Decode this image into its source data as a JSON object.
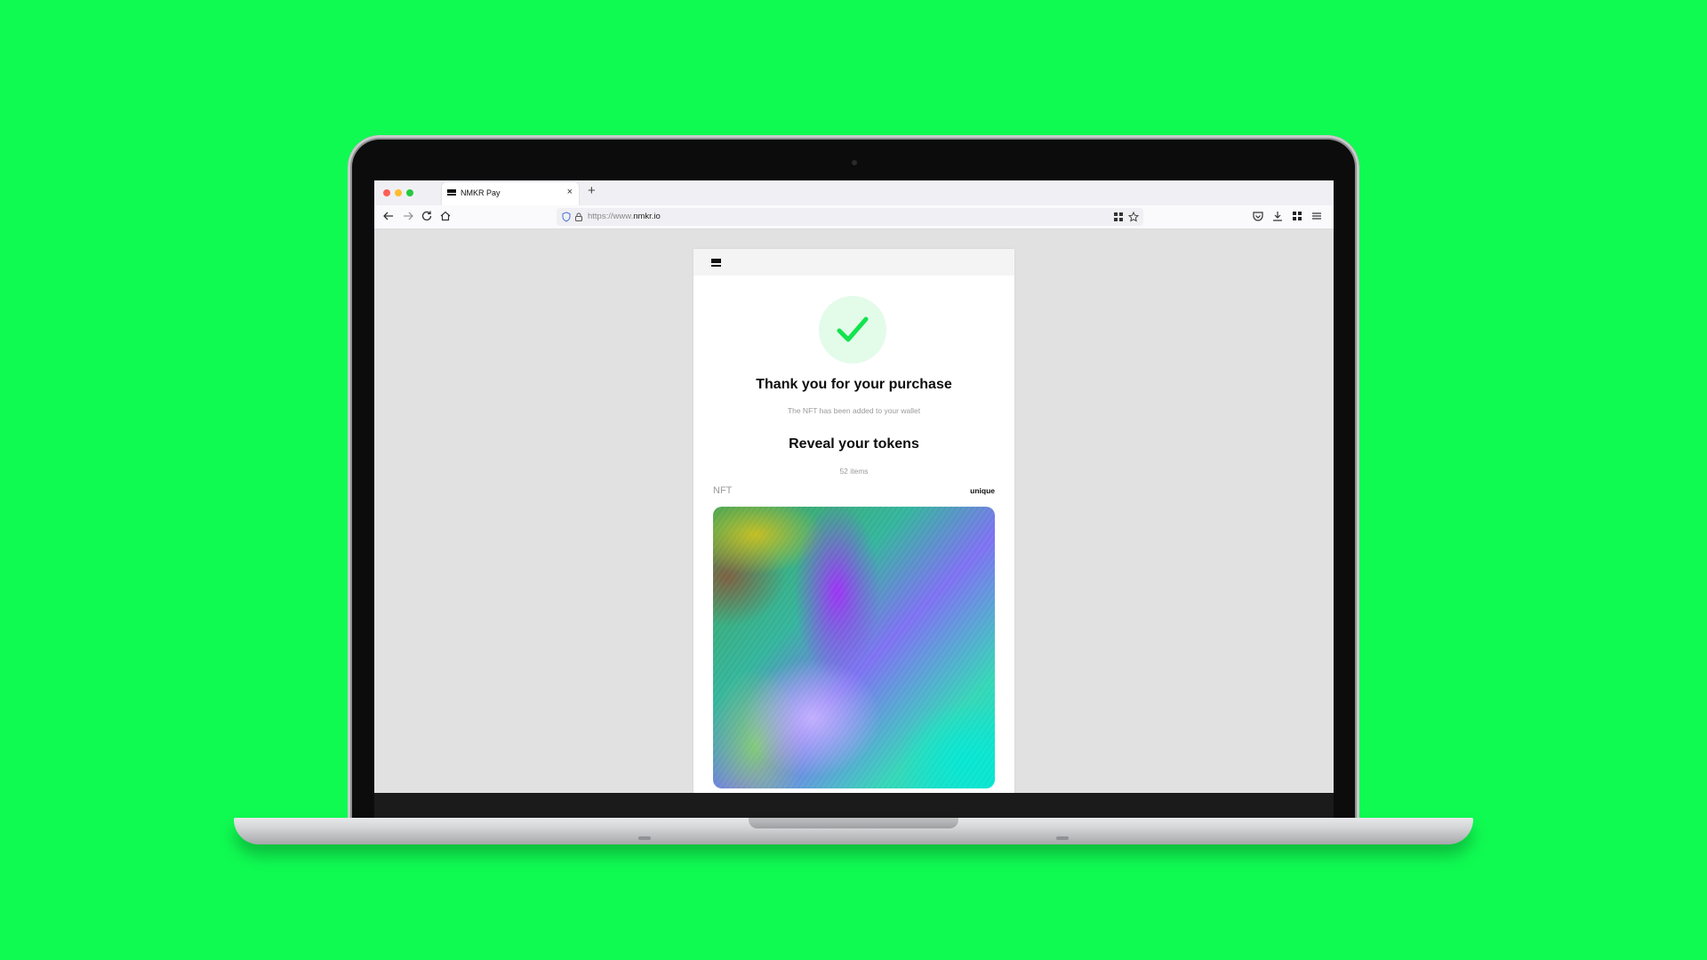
{
  "browser": {
    "tab_title": "NMKR Pay",
    "new_tab_label": "+",
    "close_label": "×",
    "url_prefix": "https://www.",
    "url_domain": "nmkr.io"
  },
  "page": {
    "title": "Thank you for your purchase",
    "subtitle": "The NFT has been added to your wallet",
    "reveal_title": "Reveal your tokens",
    "items_count": "52 items",
    "nft_label": "NFT",
    "rarity_label": "unique"
  },
  "colors": {
    "background": "#10fb52",
    "success_bg": "#e3fbe9",
    "success_check": "#13e34f"
  }
}
